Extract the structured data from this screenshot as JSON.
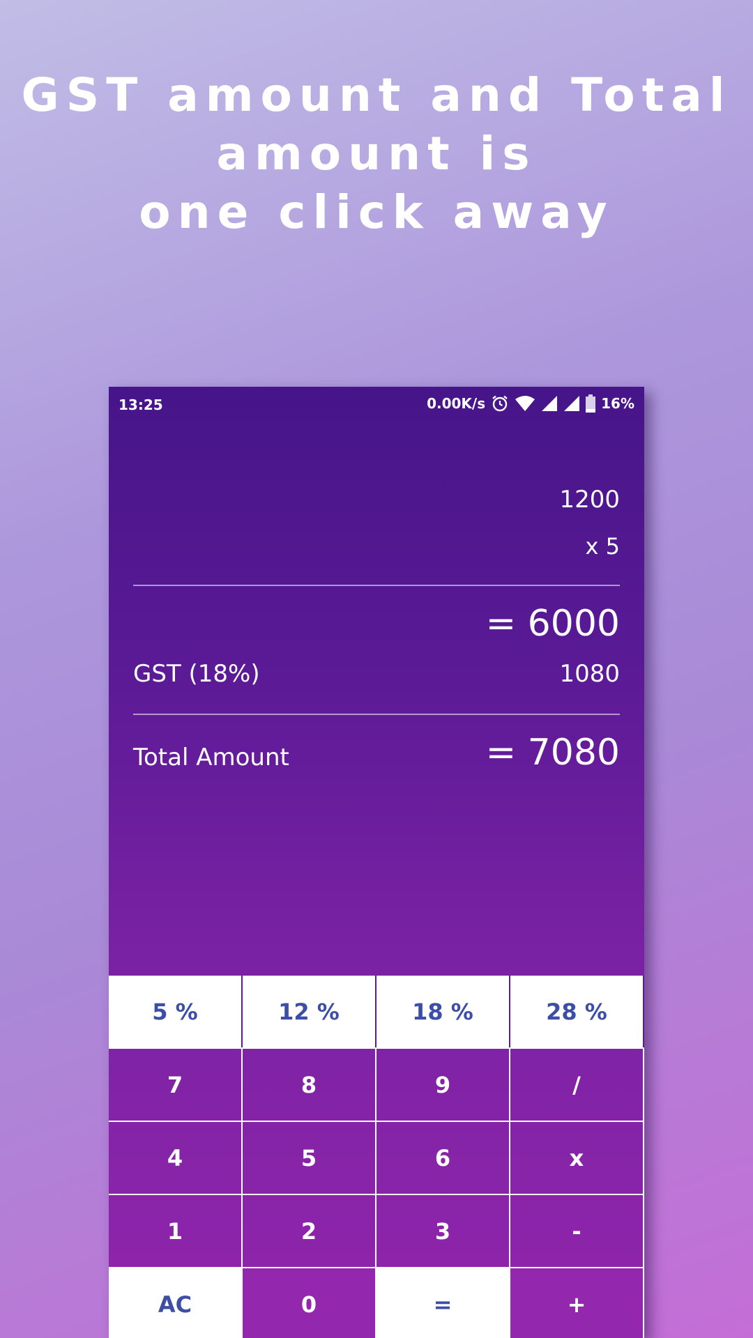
{
  "headline": {
    "line1": "GST amount and Total",
    "line2": "amount is",
    "line3": "one click away"
  },
  "status_bar": {
    "time": "13:25",
    "net_speed": "0.00K/s",
    "battery": "16%",
    "icons": [
      "alarm-icon",
      "wifi-icon",
      "signal-icon",
      "signal-icon",
      "battery-icon"
    ]
  },
  "display": {
    "operand": "1200",
    "operation": "x 5",
    "result": "= 6000",
    "gst_label": "GST (18%)",
    "gst_value": "1080",
    "total_label": "Total Amount",
    "total_value": "= 7080"
  },
  "keypad": {
    "gst_row": [
      "5 %",
      "12 %",
      "18 %",
      "28 %"
    ],
    "row1": [
      "7",
      "8",
      "9",
      "/"
    ],
    "row2": [
      "4",
      "5",
      "6",
      "x"
    ],
    "row3": [
      "1",
      "2",
      "3",
      "-"
    ],
    "row4": [
      "AC",
      "0",
      "=",
      "+"
    ]
  },
  "colors": {
    "accent_text": "#3d4ea6",
    "panel_top": "#461589",
    "panel_bottom": "#9225ac"
  }
}
